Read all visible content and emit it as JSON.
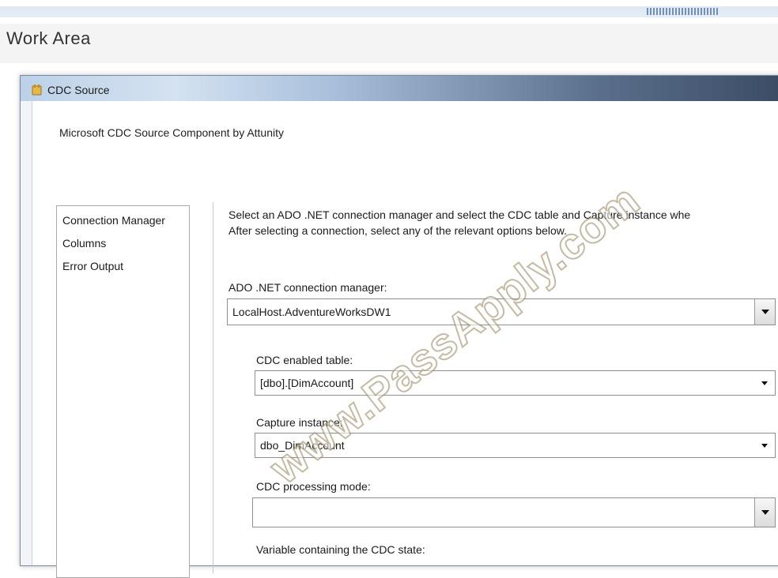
{
  "work_area": {
    "title": "Work Area"
  },
  "dialog": {
    "title": "CDC Source",
    "subtitle": "Microsoft CDC Source Component by Attunity",
    "nav": [
      "Connection Manager",
      "Columns",
      "Error Output"
    ],
    "description": [
      "Select an ADO .NET connection manager and select the CDC table and Capture instance whe",
      "After selecting a connection, select any of the relevant options below."
    ],
    "connection_manager": {
      "label": "ADO .NET connection manager:",
      "value": "LocalHost.AdventureWorksDW1"
    },
    "cdc_table": {
      "label": "CDC enabled table:",
      "value": "[dbo].[DimAccount]"
    },
    "capture_instance": {
      "label": "Capture instance:",
      "value": "dbo_DimAccount"
    },
    "processing_mode": {
      "label": "CDC processing mode:",
      "value": ""
    },
    "state_variable": {
      "label": "Variable containing the CDC state:"
    }
  },
  "watermark": "www.PassApply.com",
  "colors": {
    "titlebar_dark": "#3a4a63",
    "titlebar_light": "#bcd1e8",
    "window_bg": "#ffffff"
  }
}
